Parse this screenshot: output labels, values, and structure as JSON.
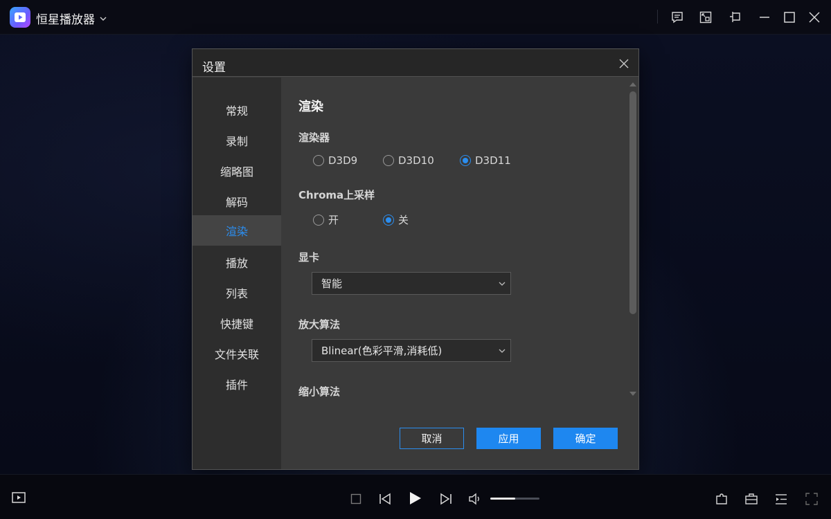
{
  "app": {
    "title": "恒星播放器",
    "accent": "#2b8ef0"
  },
  "titlebar": {
    "icons": [
      "feedback-icon",
      "picture-in-picture-icon",
      "pin-icon",
      "minimize-icon",
      "maximize-icon",
      "close-icon"
    ]
  },
  "dialog": {
    "title": "设置",
    "nav": [
      {
        "label": "常规",
        "active": false
      },
      {
        "label": "录制",
        "active": false
      },
      {
        "label": "缩略图",
        "active": false
      },
      {
        "label": "解码",
        "active": false
      },
      {
        "label": "渲染",
        "active": true
      },
      {
        "label": "播放",
        "active": false
      },
      {
        "label": "列表",
        "active": false
      },
      {
        "label": "快捷键",
        "active": false
      },
      {
        "label": "文件关联",
        "active": false
      },
      {
        "label": "插件",
        "active": false
      }
    ],
    "section_title": "渲染",
    "renderer": {
      "label": "渲染器",
      "options": [
        "D3D9",
        "D3D10",
        "D3D11"
      ],
      "selected": "D3D11"
    },
    "chroma": {
      "label": "Chroma上采样",
      "options": [
        "开",
        "关"
      ],
      "selected": "关"
    },
    "gpu": {
      "label": "显卡",
      "value": "智能"
    },
    "upscale": {
      "label": "放大算法",
      "value": "Blinear(色彩平滑,消耗低)"
    },
    "downscale": {
      "label": "缩小算法"
    },
    "buttons": {
      "cancel": "取消",
      "apply": "应用",
      "ok": "确定"
    }
  },
  "player": {
    "volume_fraction": 0.5
  }
}
